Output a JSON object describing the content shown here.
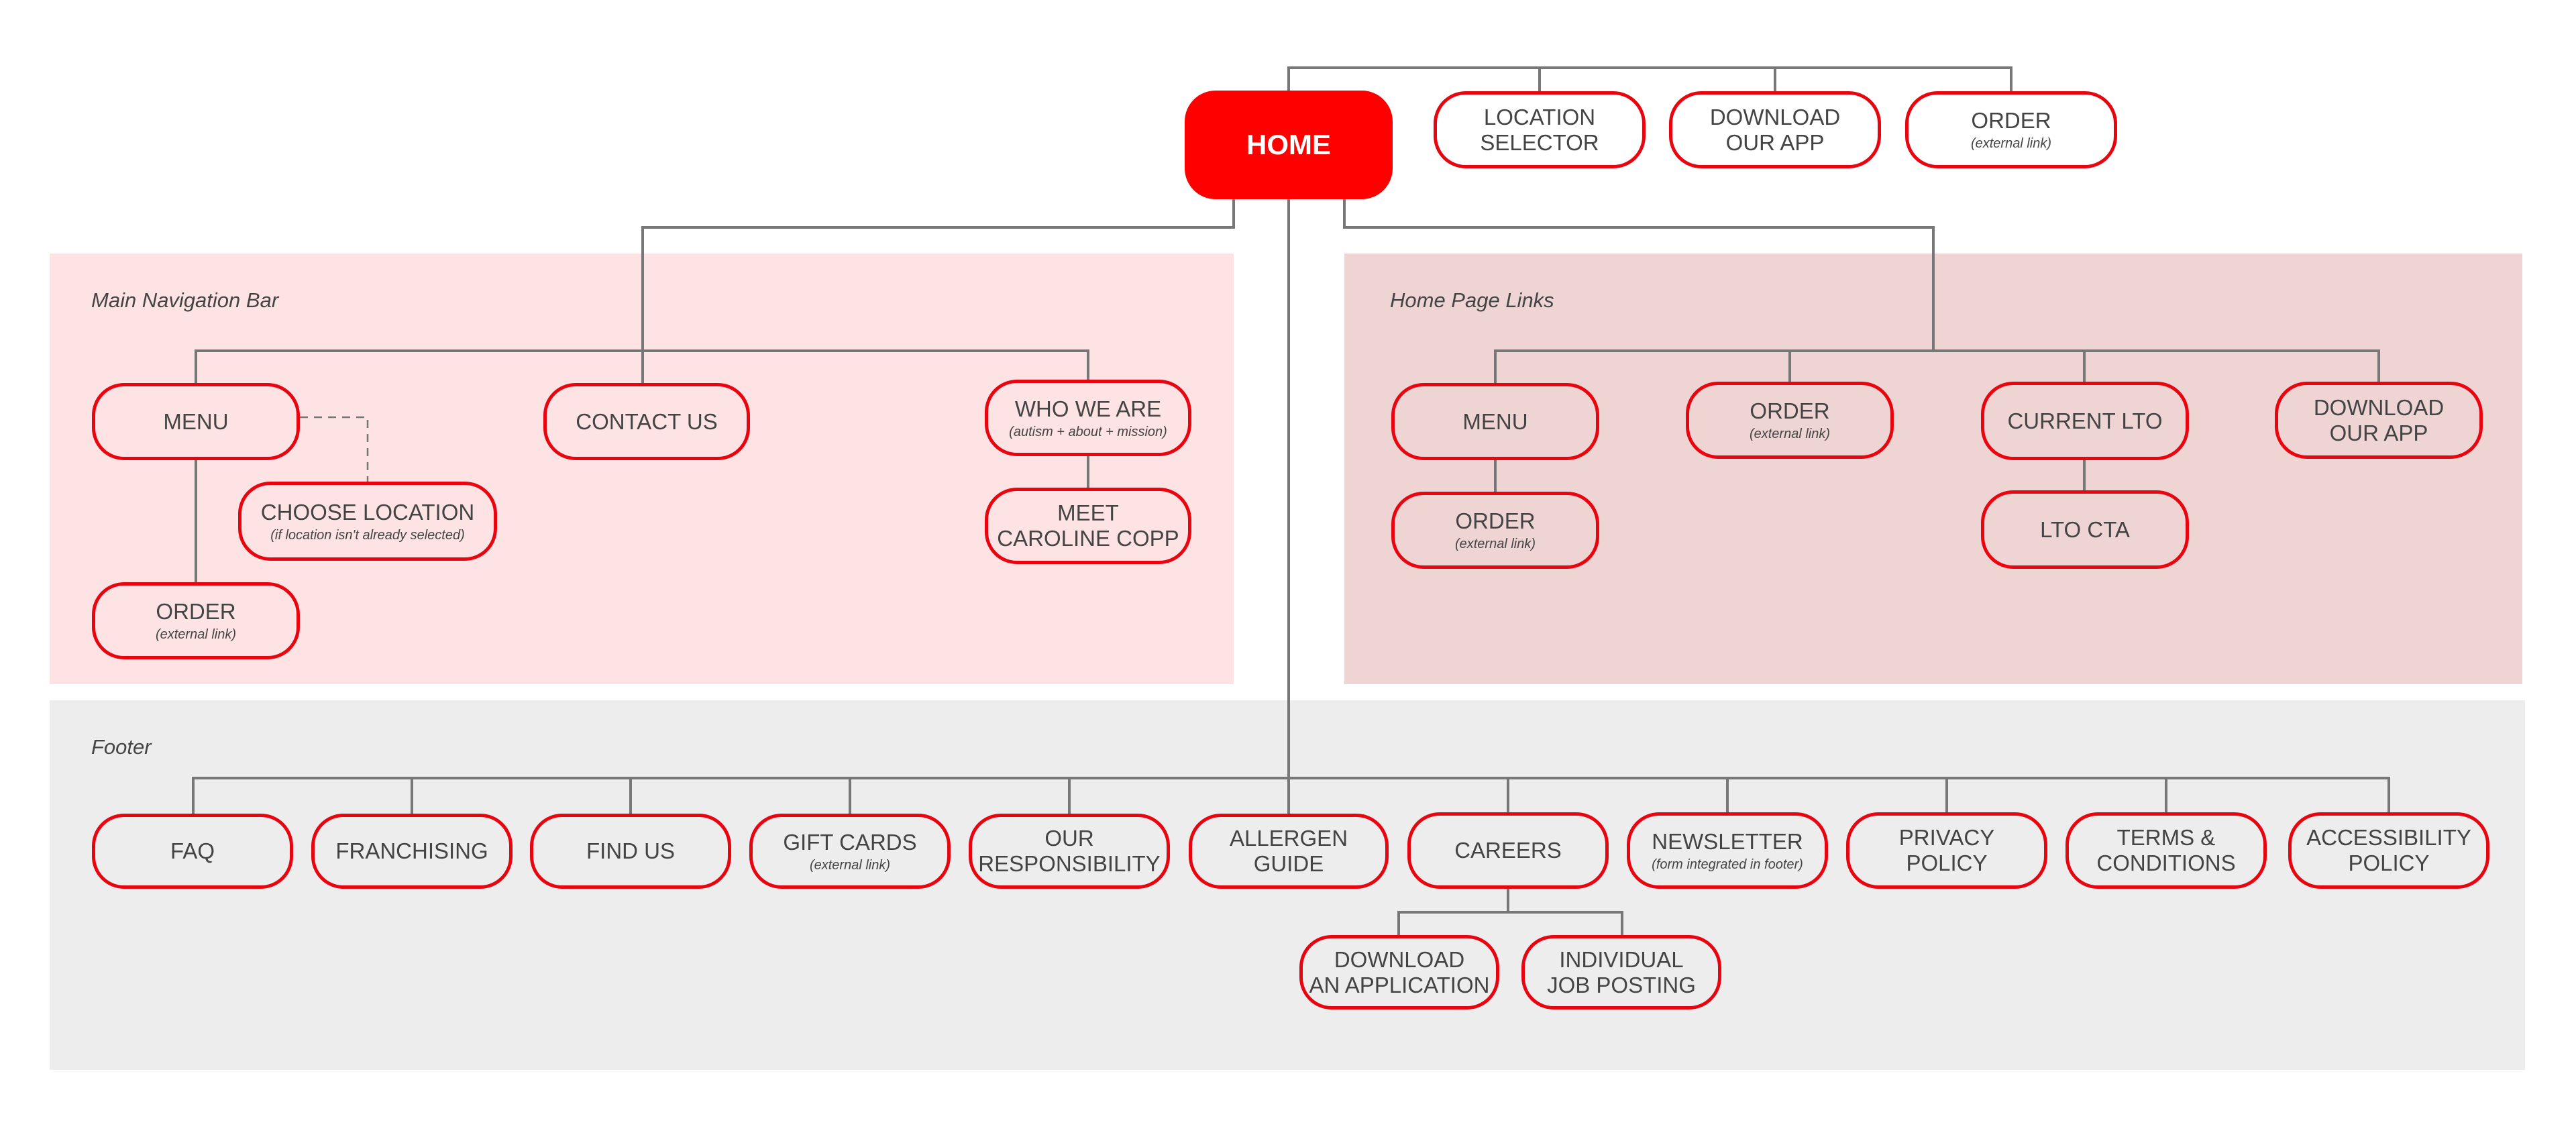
{
  "colors": {
    "accent": "#ff0000",
    "node_border": "#e8050f",
    "connector": "#777777",
    "nav_panel_bg": "#fde3e3",
    "home_links_panel_bg": "#efd4d4",
    "footer_panel_bg": "#ededed",
    "text": "#444444"
  },
  "root": {
    "label": "HOME"
  },
  "utility": [
    {
      "label": "LOCATION\nSELECTOR"
    },
    {
      "label": "DOWNLOAD\nOUR APP"
    },
    {
      "label": "ORDER",
      "note": "(external link)"
    }
  ],
  "main_nav": {
    "title": "Main Navigation Bar",
    "menu": {
      "label": "MENU"
    },
    "choose_location": {
      "label": "CHOOSE LOCATION",
      "note": "(if location isn't already selected)"
    },
    "order": {
      "label": "ORDER",
      "note": "(external link)"
    },
    "contact": {
      "label": "CONTACT US"
    },
    "who_we_are": {
      "label": "WHO WE ARE",
      "note": "(autism + about + mission)"
    },
    "meet": {
      "label": "MEET\nCAROLINE COPP"
    }
  },
  "home_links": {
    "title": "Home Page Links",
    "menu": {
      "label": "MENU"
    },
    "menu_order": {
      "label": "ORDER",
      "note": "(external link)"
    },
    "order": {
      "label": "ORDER",
      "note": "(external link)"
    },
    "current_lto": {
      "label": "CURRENT LTO"
    },
    "lto_cta": {
      "label": "LTO CTA"
    },
    "download": {
      "label": "DOWNLOAD\nOUR APP"
    }
  },
  "footer": {
    "title": "Footer",
    "items": [
      {
        "label": "FAQ"
      },
      {
        "label": "FRANCHISING"
      },
      {
        "label": "FIND US"
      },
      {
        "label": "GIFT CARDS",
        "note": "(external link)"
      },
      {
        "label": "OUR\nRESPONSIBILITY"
      },
      {
        "label": "ALLERGEN\nGUIDE"
      },
      {
        "label": "CAREERS"
      },
      {
        "label": "NEWSLETTER",
        "note": "(form integrated in footer)"
      },
      {
        "label": "PRIVACY\nPOLICY"
      },
      {
        "label": "TERMS &\nCONDITIONS"
      },
      {
        "label": "ACCESSIBILITY\nPOLICY"
      }
    ],
    "careers_children": [
      {
        "label": "DOWNLOAD\nAN APPLICATION"
      },
      {
        "label": "INDIVIDUAL\nJOB POSTING"
      }
    ]
  }
}
